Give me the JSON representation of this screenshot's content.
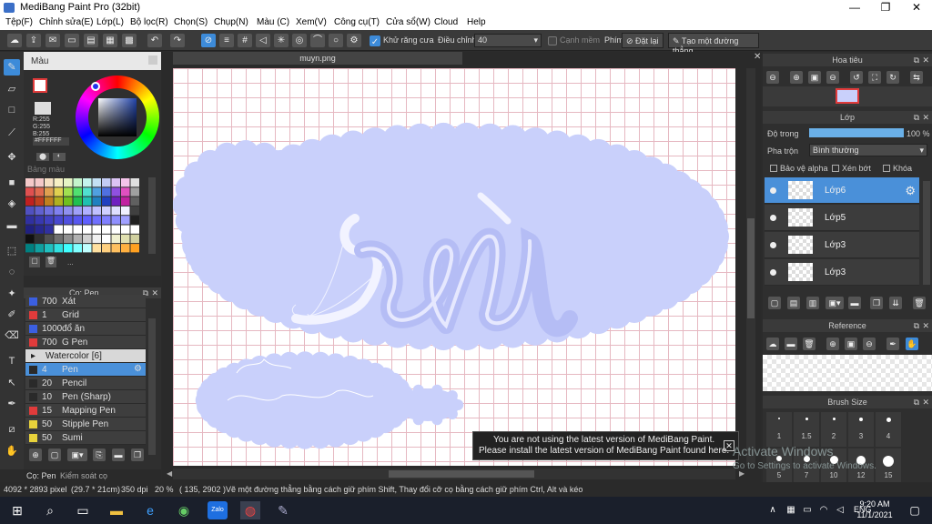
{
  "window": {
    "title": "MediBang Paint Pro (32bit)"
  },
  "menu": [
    "Tệp(F)",
    "Chỉnh sửa(E)",
    "Lớp(L)",
    "Bộ lọc(R)",
    "Chọn(S)",
    "Chụp(N)",
    "Màu (C)",
    "Xem(V)",
    "Công cụ(T)",
    "Cửa sổ(W)",
    "Cloud",
    "Help"
  ],
  "toolbar": {
    "antialias": "Khử răng cưa",
    "correction": "Điều chỉnh",
    "correction_value": "40",
    "snap": "Cạnh mềm",
    "key": "Phím",
    "set_btn": "Đặt lại",
    "line_btn": "Tạo một đường thẳng"
  },
  "color": {
    "title": "Màu",
    "r": "R:255",
    "g": "G:255",
    "b": "B:255",
    "hex": "#FFFFFF"
  },
  "palette": {
    "title": "Bảng màu",
    "more": "..."
  },
  "brush": {
    "title": "Cọ: Pen",
    "items": [
      {
        "size": "700",
        "name": "Xát",
        "color": "#3b5fe0"
      },
      {
        "size": "1",
        "name": "Grid",
        "color": "#e03b3b"
      },
      {
        "size": "1000",
        "name": "đổ ăn",
        "color": "#3b5fe0"
      },
      {
        "size": "700",
        "name": "G Pen",
        "color": "#e03b3b"
      },
      {
        "size": "",
        "name": "Watercolor [6]",
        "color": ""
      },
      {
        "size": "4",
        "name": "Pen",
        "color": "#2a2a2a"
      },
      {
        "size": "20",
        "name": "Pencil",
        "color": "#2a2a2a"
      },
      {
        "size": "10",
        "name": "Pen (Sharp)",
        "color": "#2a2a2a"
      },
      {
        "size": "15",
        "name": "Mapping Pen",
        "color": "#e03b3b"
      },
      {
        "size": "50",
        "name": "Stipple Pen",
        "color": "#e8d23b"
      },
      {
        "size": "50",
        "name": "Sumi",
        "color": "#e8d23b"
      }
    ]
  },
  "tabs": {
    "brush": "Cọ: Pen",
    "control": "Kiểm soát cọ"
  },
  "doc": {
    "tab": "muyn.png"
  },
  "navigator": {
    "title": "Hoa tiêu"
  },
  "layers": {
    "title": "Lớp",
    "opacity_label": "Độ trong",
    "opacity": "100 %",
    "blend_label": "Pha trộn",
    "blend": "Bình thường",
    "protect": "Bảo vệ alpha",
    "clip": "Xén bớt",
    "lock": "Khóa",
    "items": [
      {
        "name": "Lớp6",
        "selected": true
      },
      {
        "name": "Lớp5",
        "selected": false
      },
      {
        "name": "Lớp3",
        "selected": false
      },
      {
        "name": "Lớp3",
        "selected": false
      }
    ]
  },
  "reference": {
    "title": "Reference"
  },
  "brushsize": {
    "title": "Brush Size",
    "row1": [
      "1",
      "1.5",
      "2",
      "3",
      "4"
    ],
    "row2": [
      "5",
      "7",
      "10",
      "12",
      "15"
    ]
  },
  "notice": {
    "line1": "You are not using the latest version of MediBang Paint.",
    "line2": "Please install the latest version of MediBang Paint found here."
  },
  "status": {
    "size": "4092 * 2893 pixel",
    "cm": "(29.7 * 21cm)",
    "dpi": "350 dpi",
    "zoom": "20 %",
    "coord": "( 135, 2902 )",
    "hint": "Vẽ một đường thẳng bằng cách giữ phím Shift, Thay đổi cỡ cọ bằng cách giữ phím Ctrl, Alt và kéo"
  },
  "watermark": {
    "line1": "Activate Windows",
    "line2": "Go to Settings to activate Windows."
  },
  "taskbar": {
    "lang": "ENG",
    "time": "9:20 AM",
    "date": "11/1/2021"
  },
  "colors": {
    "accent": "#3d8bd9",
    "canvasBlob": "#c9d0fb",
    "strokeLight": "#f0f2ff",
    "strokeMid": "#b5bdf5"
  }
}
